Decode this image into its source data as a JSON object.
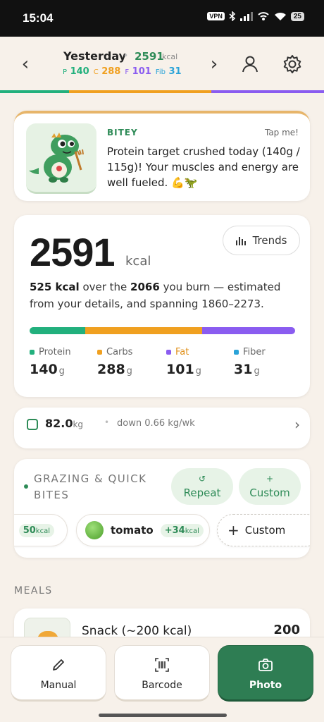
{
  "status": {
    "time": "15:04",
    "vpn": "VPN",
    "battery": "25"
  },
  "header": {
    "prev_label": "‹",
    "next_label": "›",
    "date": "Yesterday",
    "kcal": "2591",
    "kcal_unit": "kcal",
    "macros": [
      {
        "key": "P",
        "value": "140"
      },
      {
        "key": "C",
        "value": "288"
      },
      {
        "key": "F",
        "value": "101"
      },
      {
        "key": "Fib",
        "value": "31"
      }
    ],
    "progress_colors": [
      "#22b07d",
      "#f0a020",
      "#8a5cf0"
    ]
  },
  "bitey": {
    "name": "BITEY",
    "tap": "Tap me!",
    "message": "Protein target crushed today (140g / 115g)! Your muscles and energy are well fueled. 💪🦖"
  },
  "summary": {
    "kcal": "2591",
    "unit": "kcal",
    "trends_label": "Trends",
    "surplus": "525 kcal",
    "desc_mid": " over the ",
    "burn": "2066",
    "desc_end": " you burn — estimated from your details, and spanning 1860–2273.",
    "macro_bar": [
      {
        "name": "protein",
        "fraction": 0.21,
        "color": "#22b07d"
      },
      {
        "name": "carbs",
        "fraction": 0.44,
        "color": "#f0a020"
      },
      {
        "name": "fat",
        "fraction": 0.35,
        "color": "#8a5cf0"
      }
    ],
    "macros": [
      {
        "label": "Protein",
        "value": "140",
        "unit": "g",
        "color": "#22b07d",
        "label_color": "#666"
      },
      {
        "label": "Carbs",
        "value": "288",
        "unit": "g",
        "color": "#f0a020",
        "label_color": "#666"
      },
      {
        "label": "Fat",
        "value": "101",
        "unit": "g",
        "color": "#8a5cf0",
        "label_color": "#e0901a"
      },
      {
        "label": "Fiber",
        "value": "31",
        "unit": "g",
        "color": "#2aa3d8",
        "label_color": "#666"
      }
    ]
  },
  "weight": {
    "value": "82.0",
    "unit": "kg",
    "trend": "down 0.66 kg/wk"
  },
  "grazing": {
    "title": "GRAZING & QUICK BITES",
    "repeat_label": "Repeat",
    "custom_label": "Custom",
    "chips": [
      {
        "kcal": "50",
        "unit": "kcal"
      },
      {
        "name": "tomato",
        "kcal": "+34",
        "unit": "kcal"
      }
    ],
    "custom_chip_label": "Custom"
  },
  "meals": {
    "header": "MEALS",
    "items": [
      {
        "name": "Snack (~200 kcal)",
        "value": "200"
      }
    ]
  },
  "actions": {
    "manual": "Manual",
    "barcode": "Barcode",
    "photo": "Photo"
  }
}
